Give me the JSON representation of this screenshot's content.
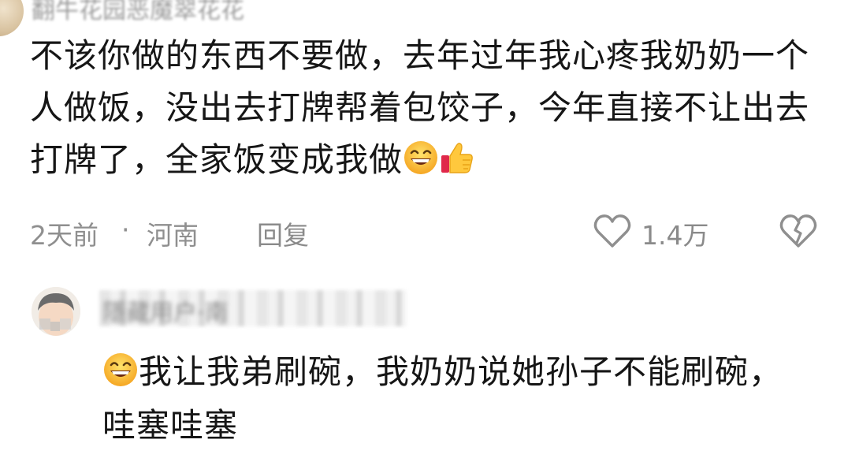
{
  "top_comment": {
    "username": "翻牛花园恶魔翠花花",
    "text_before_emoji": "不该你做的东西不要做，去年过年我心疼我奶奶一个人做饭，没出去打牌帮着包饺子，今年直接不让出去打牌了，全家饭变成我做",
    "emojis": [
      "grinning-face-icon",
      "thumbs-up-icon"
    ],
    "time": "2天前",
    "separator": "·",
    "location": "河南",
    "reply_label": "回复",
    "like_count": "1.4万"
  },
  "reply_comment": {
    "username": "隱藏用户·南",
    "emoji": "grinning-face-icon",
    "text": "我让我弟刷碗，我奶奶说她孙子不能刷碗，哇塞哇塞"
  }
}
